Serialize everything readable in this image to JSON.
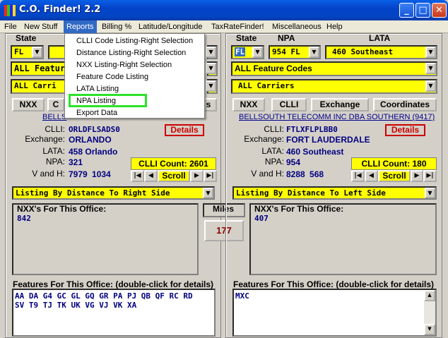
{
  "window": {
    "title": "C.O. Finder! 2.2",
    "min_glyph": "_",
    "max_glyph": "□",
    "close_glyph": "✕"
  },
  "menu": [
    "File",
    "New Stuff",
    "Reports",
    "Billing %",
    "Latitude/Longitude",
    "TaxRateFinder!",
    "Miscellaneous",
    "Help"
  ],
  "reports_menu": [
    "CLLI Code Listing-Right Selection",
    "Distance Listing-Right Selection",
    "NXX Listing-Right Selection",
    "Feature Code Listing",
    "LATA Listing",
    "NPA Listing",
    "Export Data"
  ],
  "left": {
    "state_label": "State",
    "state_value": "FL",
    "npa_value": "",
    "feature_value": "ALL Feature",
    "carrier_value": "ALL Carri",
    "btn_nxx": "NXX",
    "btn_clli_partial": "C",
    "btn_coord_partial": "s",
    "carrier_link": "BELLS",
    "clli_label": "CLLI:",
    "clli_value": "ORLDFLSADS0",
    "exchange_label": "Exchange:",
    "exchange_value": "ORLANDO",
    "lata_label": "LATA:",
    "lata_value": "458  Orlando",
    "npa_label": "NPA:",
    "npa_value2": "321",
    "vh_label": "V and H:",
    "vh_value": "7979  1034",
    "details": "Details",
    "clli_count": "CLLI Count: 2601",
    "scroll": "Scroll",
    "listing": "Listing By Distance To Right Side",
    "nxx_head": "NXX's For This Office:",
    "nxx_value": "842",
    "features_head": "Features For This Office: (double-click for details)",
    "features_line1": "AA DA G4 GC GL GQ GR PA PJ QB QF RC RD",
    "features_line2": "SV T9 TJ TK UK VG VJ VK XA"
  },
  "miles": {
    "label": "Miles",
    "value": "177"
  },
  "right": {
    "state_label": "State",
    "npa_label_top": "NPA",
    "lata_label_top": "LATA",
    "state_value": "FL",
    "npa_value": "954 FL",
    "lata_value": "460  Southeast",
    "feature_value": "ALL Feature Codes",
    "carrier_value": "ALL Carriers",
    "btn_nxx": "NXX",
    "btn_clli": "CLLI",
    "btn_exchange": "Exchange",
    "btn_coord": "Coordinates",
    "carrier_link": "BELLSOUTH TELECOMM INC DBA SOUTHERN (9417)",
    "clli_label": "CLLI:",
    "clli_value": "FTLXFLPLBB0",
    "exchange_label": "Exchange:",
    "exchange_value": "FORT LAUDERDALE",
    "lata_label": "LATA:",
    "npa_label": "NPA:",
    "npa_value2": "954",
    "vh_label": "V and H:",
    "vh_value": "8288  568",
    "details": "Details",
    "clli_count": "CLLI Count: 180",
    "scroll": "Scroll",
    "listing": "Listing By Distance To Left Side",
    "nxx_head": "NXX's For This Office:",
    "nxx_value": "407",
    "features_head": "Features For This Office: (double-click for details)",
    "features_line1": "MXC"
  },
  "colors": {
    "highlight": "#2be22b",
    "field": "#ffff00",
    "value_text": "#000080",
    "menu_select": "#316ac5"
  }
}
